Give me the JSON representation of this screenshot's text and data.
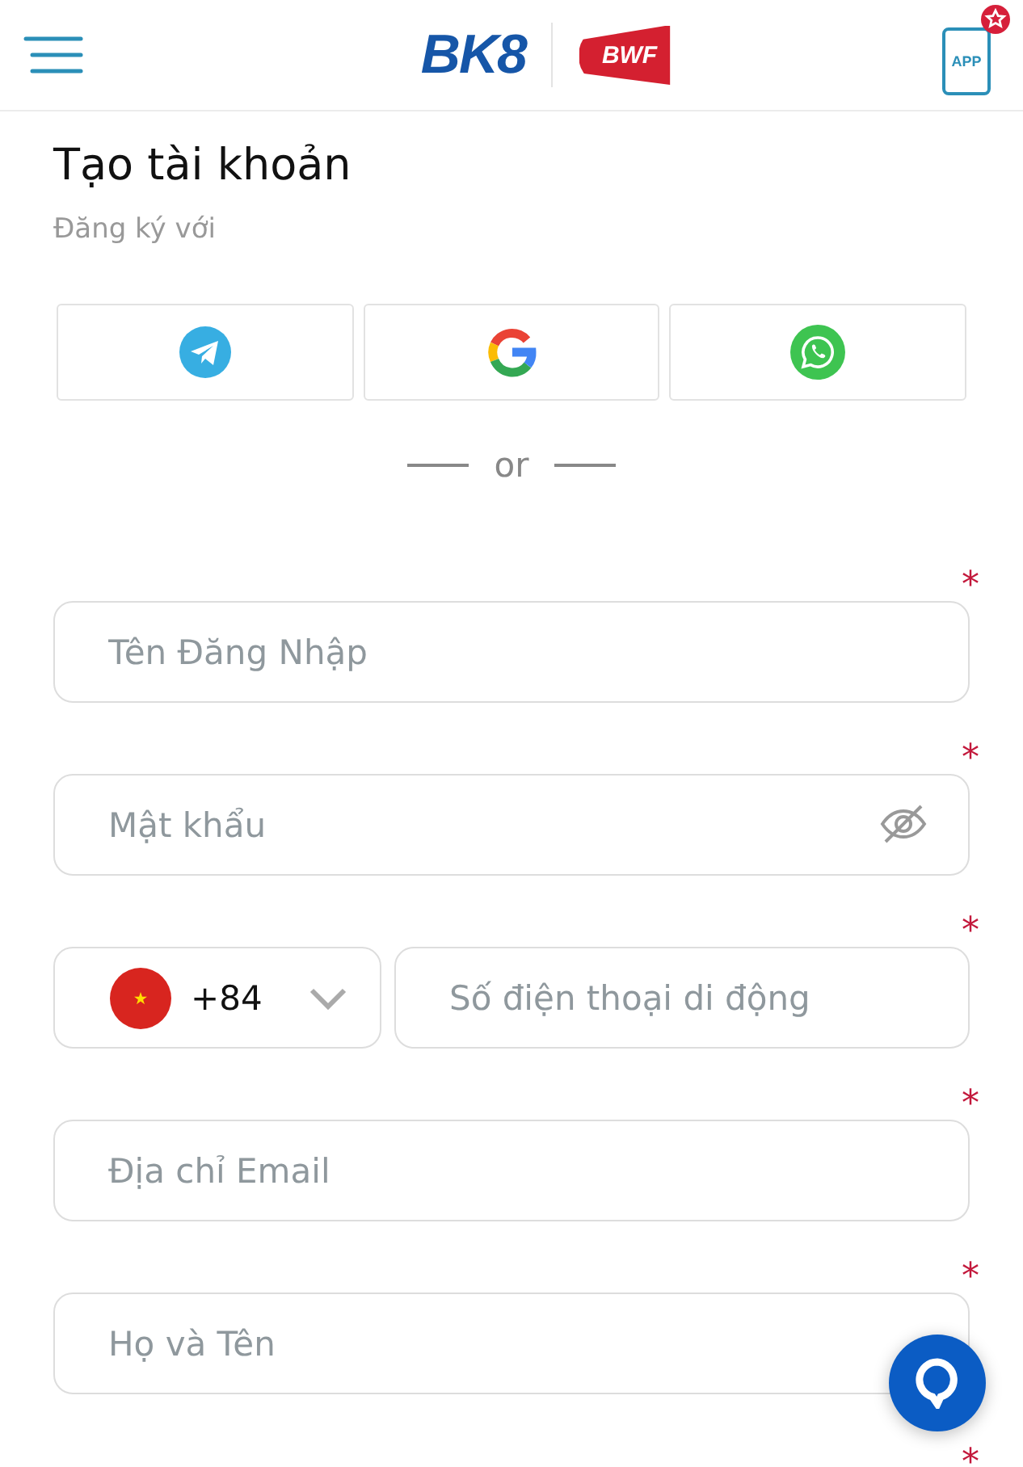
{
  "header": {
    "brand": "BK8",
    "partner": "BWF",
    "app_badge": "APP"
  },
  "title": "Tạo tài khoản",
  "subtitle": "Đăng ký với",
  "social": [
    {
      "kind": "telegram"
    },
    {
      "kind": "google"
    },
    {
      "kind": "whatsapp"
    }
  ],
  "separator": "or",
  "fields": [
    {
      "kind": "text",
      "placeholder": "Tên Đăng Nhập",
      "required_mark": "*"
    },
    {
      "kind": "password",
      "placeholder": "Mật khẩu",
      "required_mark": "*"
    },
    {
      "kind": "phone",
      "dial_code": "+84",
      "placeholder": "Số điện thoại di động",
      "required_mark": "*"
    },
    {
      "kind": "text",
      "placeholder": "Địa chỉ Email",
      "required_mark": "*"
    },
    {
      "kind": "text",
      "placeholder": "Họ và Tên",
      "required_mark": "*"
    }
  ],
  "next_field": {
    "required_mark": "*"
  }
}
